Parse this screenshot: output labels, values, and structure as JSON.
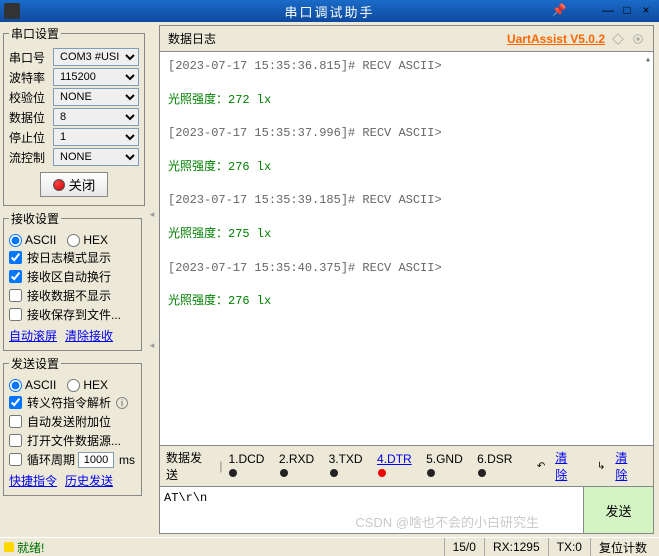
{
  "title": "串口调试助手",
  "version": "UartAssist V5.0.2",
  "serial": {
    "legend": "串口设置",
    "rows": {
      "port": {
        "label": "串口号",
        "value": "COM3 #USI"
      },
      "baud": {
        "label": "波特率",
        "value": "115200"
      },
      "parity": {
        "label": "校验位",
        "value": "NONE"
      },
      "data": {
        "label": "数据位",
        "value": "8"
      },
      "stop": {
        "label": "停止位",
        "value": "1"
      },
      "flow": {
        "label": "流控制",
        "value": "NONE"
      }
    },
    "close_btn": "关闭"
  },
  "recv": {
    "legend": "接收设置",
    "ascii": "ASCII",
    "hex": "HEX",
    "opts": [
      "按日志模式显示",
      "接收区自动换行",
      "接收数据不显示",
      "接收保存到文件..."
    ],
    "checked": [
      true,
      true,
      false,
      false
    ],
    "links": {
      "scroll": "自动滚屏",
      "clear": "清除接收"
    }
  },
  "send": {
    "legend": "发送设置",
    "ascii": "ASCII",
    "hex": "HEX",
    "opts": [
      "转义符指令解析",
      "自动发送附加位",
      "打开文件数据源...",
      "循环周期"
    ],
    "checked": [
      true,
      false,
      false,
      false
    ],
    "cycle_value": "1000",
    "cycle_unit": "ms",
    "links": {
      "quick": "快捷指令",
      "history": "历史发送"
    }
  },
  "log": {
    "header": "数据日志",
    "lines": [
      {
        "cls": "gray",
        "text": "[2023-07-17 15:35:36.815]# RECV ASCII>"
      },
      {
        "cls": "",
        "text": " "
      },
      {
        "cls": "green",
        "text": "光照强度：272 lx"
      },
      {
        "cls": "",
        "text": " "
      },
      {
        "cls": "gray",
        "text": "[2023-07-17 15:35:37.996]# RECV ASCII>"
      },
      {
        "cls": "",
        "text": " "
      },
      {
        "cls": "green",
        "text": "光照强度：276 lx"
      },
      {
        "cls": "",
        "text": " "
      },
      {
        "cls": "gray",
        "text": "[2023-07-17 15:35:39.185]# RECV ASCII>"
      },
      {
        "cls": "",
        "text": " "
      },
      {
        "cls": "green",
        "text": "光照强度：275 lx"
      },
      {
        "cls": "",
        "text": " "
      },
      {
        "cls": "gray",
        "text": "[2023-07-17 15:35:40.375]# RECV ASCII>"
      },
      {
        "cls": "",
        "text": " "
      },
      {
        "cls": "green",
        "text": "光照强度：276 lx"
      }
    ]
  },
  "tabs": {
    "label": "数据发送",
    "items": [
      "1.DCD",
      "2.RXD",
      "3.TXD",
      "4.DTR",
      "5.GND",
      "6.DSR"
    ],
    "clear_left": "清除",
    "clear_right": "清除"
  },
  "send_box": {
    "value": "AT\\r\\n",
    "btn": "发送"
  },
  "status": {
    "ready": "就绪!",
    "col2": "15/0",
    "rx": "RX:1295",
    "tx": "TX:0",
    "reset": "复位计数"
  },
  "watermark": "CSDN @啥也不会的小白研究生"
}
